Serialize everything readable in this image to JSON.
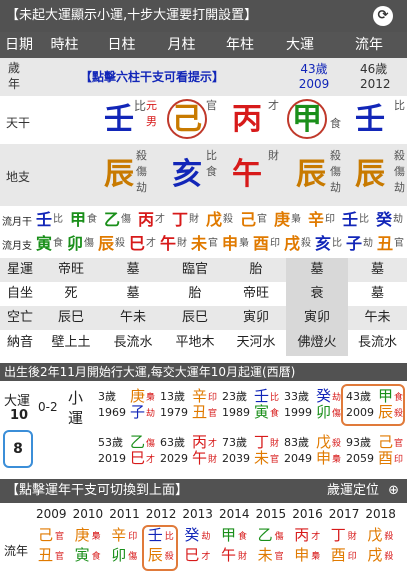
{
  "top_bar": {
    "title": "【未起大運顯示小運,十步大運要打開設置】",
    "refresh_icon": "refresh-icon"
  },
  "header": [
    "日期",
    "時柱",
    "日柱",
    "月柱",
    "年柱",
    "大運",
    "流年"
  ],
  "age_row": {
    "label": "歲\n年",
    "hint": "【點擊六柱干支可看提示】",
    "dayun_age": "43歲",
    "dayun_year": "2009",
    "liunian_age": "46歲",
    "liunian_year": "2012"
  },
  "tiangan": {
    "label": "天干",
    "hour": "壬",
    "hour_tag": "比",
    "day_tags": [
      "元",
      "男"
    ],
    "day": "己",
    "month": "丙",
    "month_tag": "官",
    "year_tag": "才",
    "dayun": "甲",
    "dayun_tag": "食",
    "liunian": "壬",
    "liunian_tag": "比"
  },
  "dizhi": {
    "label": "地支",
    "hour": "辰",
    "hour_tags": [
      "殺",
      "傷",
      "劫"
    ],
    "day": "亥",
    "day_tags": [
      "比",
      "食"
    ],
    "month": "午",
    "month_tags": [
      "財"
    ],
    "year": "辰",
    "year_tags": [
      "殺",
      "傷",
      "劫"
    ],
    "dayun": "辰",
    "dayun_tags": [
      "殺",
      "傷",
      "劫"
    ],
    "liunian": "辰"
  },
  "lnyue_row": {
    "label": "流月干",
    "items": [
      [
        "壬",
        "比"
      ],
      [
        "甲",
        "食"
      ],
      [
        "乙",
        "傷"
      ],
      [
        "丙",
        "才"
      ],
      [
        "丁",
        "財"
      ],
      [
        "戊",
        "殺"
      ],
      [
        "己",
        "官"
      ],
      [
        "庚",
        "梟"
      ],
      [
        "辛",
        "印"
      ],
      [
        "壬",
        "比"
      ],
      [
        "癸",
        "劫"
      ]
    ]
  },
  "lnyue_zhi": {
    "label": "流月支",
    "items": [
      [
        "寅",
        "食"
      ],
      [
        "卯",
        "傷"
      ],
      [
        "辰",
        "殺"
      ],
      [
        "巳",
        "才"
      ],
      [
        "午",
        "財"
      ],
      [
        "未",
        "官"
      ],
      [
        "申",
        "梟"
      ],
      [
        "酉",
        "印"
      ],
      [
        "戌",
        "殺"
      ],
      [
        "亥",
        "比"
      ],
      [
        "子",
        "劫"
      ],
      [
        "丑",
        "官"
      ]
    ]
  },
  "xingyun": {
    "label": "星運",
    "vals": [
      "帝旺",
      "墓",
      "臨官",
      "胎",
      "墓",
      "墓"
    ]
  },
  "zizuo": {
    "label": "自坐",
    "vals": [
      "死",
      "墓",
      "胎",
      "帝旺",
      "衰",
      "墓"
    ]
  },
  "kongwang": {
    "label": "空亡",
    "vals": [
      "辰巳",
      "午未",
      "辰巳",
      "寅卯",
      "寅卯",
      "午未"
    ]
  },
  "nayin": {
    "label": "納音",
    "vals": [
      "壁上土",
      "長流水",
      "平地木",
      "天河水",
      "佛燈火",
      "長流水"
    ]
  },
  "mid_bar": "出生後2年11月開始行大運,每交大運年10月起運(西曆)",
  "dayun_block": {
    "label": "大運",
    "num": "10",
    "range": "0-2",
    "xiaoyun": "小\n運",
    "current": "8",
    "rows": [
      [
        {
          "age": "3歲",
          "year": "1969",
          "gan": "庚",
          "zhi": "子",
          "g": "梟",
          "z": "劫"
        },
        {
          "age": "13歲",
          "year": "1979",
          "gan": "辛",
          "zhi": "丑",
          "g": "印",
          "z": "官"
        },
        {
          "age": "23歲",
          "year": "1989",
          "gan": "壬",
          "zhi": "寅",
          "g": "比",
          "z": "食"
        },
        {
          "age": "33歲",
          "year": "1999",
          "gan": "癸",
          "zhi": "卯",
          "g": "劫",
          "z": "傷"
        },
        {
          "age": "43歲",
          "year": "2009",
          "gan": "甲",
          "zhi": "辰",
          "g": "食",
          "z": "殺"
        }
      ],
      [
        {
          "age": "53歲",
          "year": "2019",
          "gan": "乙",
          "zhi": "巳",
          "g": "傷",
          "z": "才"
        },
        {
          "age": "63歲",
          "year": "2029",
          "gan": "丙",
          "zhi": "午",
          "g": "才",
          "z": "財"
        },
        {
          "age": "73歲",
          "year": "2039",
          "gan": "丁",
          "zhi": "未",
          "g": "財",
          "z": "官"
        },
        {
          "age": "83歲",
          "year": "2049",
          "gan": "戊",
          "zhi": "申",
          "g": "殺",
          "z": "梟"
        },
        {
          "age": "93歲",
          "year": "2059",
          "gan": "己",
          "zhi": "酉",
          "g": "官",
          "z": "印"
        }
      ]
    ]
  },
  "bottom_bar": {
    "left": "【點擊運年干支可切換到上面】",
    "right": "歲運定位",
    "target_icon": "target-icon"
  },
  "liunian": {
    "label": "流年",
    "years": [
      "2009",
      "2010",
      "2011",
      "2012",
      "2013",
      "2014",
      "2015",
      "2016",
      "2017",
      "2018"
    ],
    "items": [
      [
        "己",
        "官",
        "丑",
        "官"
      ],
      [
        "庚",
        "梟",
        "寅",
        "食"
      ],
      [
        "辛",
        "印",
        "卯",
        "傷"
      ],
      [
        "壬",
        "比",
        "辰",
        "殺"
      ],
      [
        "癸",
        "劫",
        "巳",
        "才"
      ],
      [
        "甲",
        "食",
        "午",
        "財"
      ],
      [
        "乙",
        "傷",
        "未",
        "官"
      ],
      [
        "丙",
        "才",
        "申",
        "梟"
      ],
      [
        "丁",
        "財",
        "酉",
        "印"
      ],
      [
        "戊",
        "殺",
        "戌",
        "殺"
      ]
    ]
  }
}
